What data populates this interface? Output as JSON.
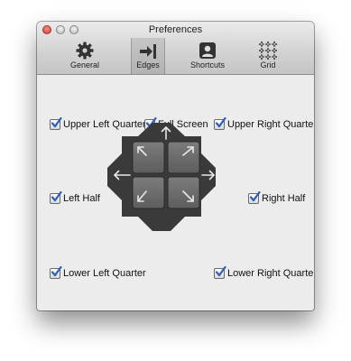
{
  "window": {
    "title": "Preferences"
  },
  "toolbar": {
    "items": [
      {
        "label": "General",
        "icon": "gear-icon"
      },
      {
        "label": "Edges",
        "icon": "arrow-to-edge-icon",
        "selected": true
      },
      {
        "label": "Shortcuts",
        "icon": "person-card-icon"
      },
      {
        "label": "Grid",
        "icon": "grid-icon"
      }
    ]
  },
  "options": {
    "upper_left_quarter": {
      "label": "Upper Left Quarter",
      "checked": true
    },
    "full_screen": {
      "label": "Full Screen",
      "checked": true
    },
    "upper_right_quarter": {
      "label": "Upper Right Quarter",
      "checked": true
    },
    "left_half": {
      "label": "Left Half",
      "checked": true
    },
    "right_half": {
      "label": "Right Half",
      "checked": true
    },
    "lower_left_quarter": {
      "label": "Lower Left Quarter",
      "checked": true
    },
    "lower_right_quarter": {
      "label": "Lower Right Quarter",
      "checked": true
    }
  },
  "colors": {
    "accent_check": "#2b5fbf",
    "pad_dark": "#3a3a3a",
    "pad_tile": "#6e6e6e"
  }
}
